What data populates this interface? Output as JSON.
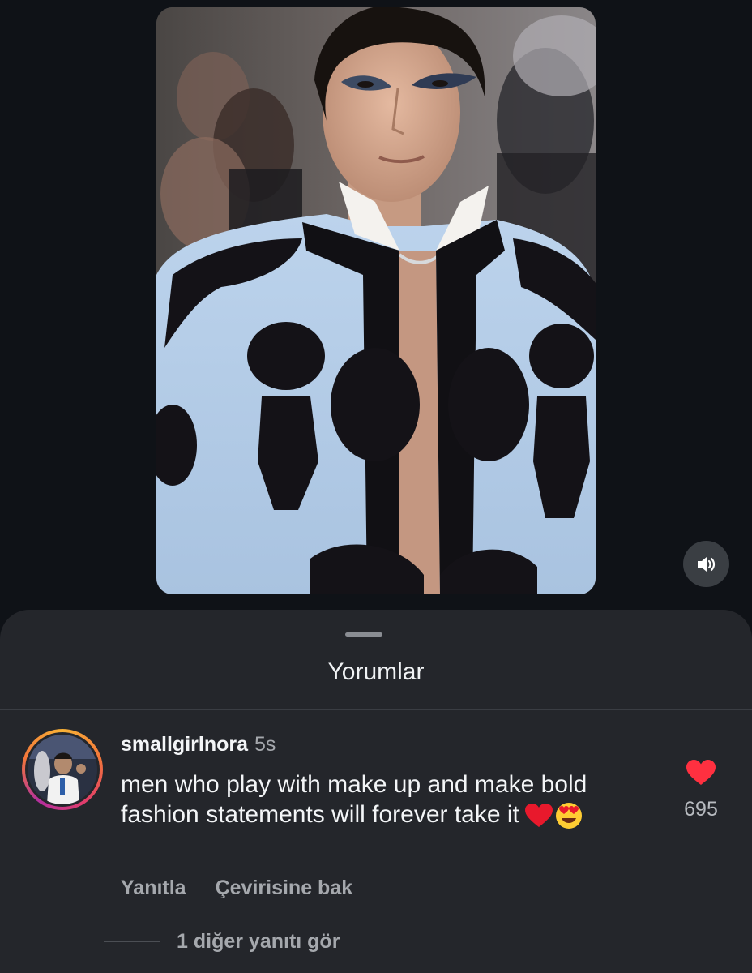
{
  "media": {
    "description_icon": "volume-on-icon",
    "image": "red-carpet-photo"
  },
  "sheet": {
    "title": "Yorumlar"
  },
  "comment": {
    "username": "smallgirlnora",
    "time": "5s",
    "text": "men who play with make up and make bold fashion statements will forever take it",
    "emojis": [
      "red-heart-emoji",
      "heart-eyes-emoji"
    ],
    "reply_label": "Yanıtla",
    "translate_label": "Çevirisine bak",
    "like_count": "695",
    "like_color": "#ff3040",
    "view_replies_label": "1 diğer yanıtı gör"
  },
  "colors": {
    "background": "#0f1217",
    "sheet": "#24262b",
    "muted_text": "#a5a8ad"
  }
}
